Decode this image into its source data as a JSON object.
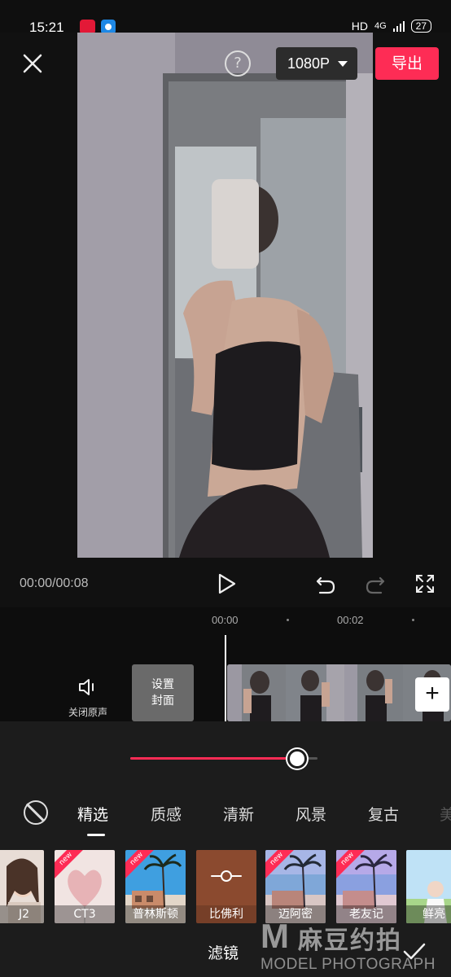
{
  "status_bar": {
    "time": "15:21",
    "right_text": "HD",
    "network": "4G",
    "battery": "27"
  },
  "top_bar": {
    "help_label": "?",
    "resolution": "1080P",
    "export_label": "导出",
    "icons": {
      "close": "close-icon",
      "help": "help-icon"
    }
  },
  "playback": {
    "timecode": "00:00/00:08",
    "icons": [
      "play-icon",
      "undo-icon",
      "redo-icon",
      "fullscreen-icon"
    ]
  },
  "timeline": {
    "ruler": [
      "00:00",
      "00:02"
    ],
    "mute_label": "关闭原声",
    "cover_label_line1": "设置",
    "cover_label_line2": "封面",
    "add_label": "+"
  },
  "filter_panel": {
    "intensity": 0.89,
    "tabs": [
      "精选",
      "质感",
      "清新",
      "风景",
      "复古"
    ],
    "active_tab": "精选",
    "filters": [
      {
        "name": "J2",
        "new": false
      },
      {
        "name": "CT3",
        "new": true
      },
      {
        "name": "普林斯顿",
        "new": true
      },
      {
        "name": "比佛利",
        "new": false,
        "selected": true
      },
      {
        "name": "迈阿密",
        "new": true
      },
      {
        "name": "老友记",
        "new": true
      },
      {
        "name": "鲜亮",
        "new": false
      }
    ],
    "badge_text": "new",
    "title": "滤镜"
  },
  "watermark": {
    "logo_letter": "M",
    "cn": "麻豆约拍",
    "en": "MODEL PHOTOGRAPH"
  },
  "colors": {
    "accent": "#fe2c55",
    "selected_filter": "#8b4a2f",
    "background": "#111111",
    "panel": "#1c1c1c"
  }
}
